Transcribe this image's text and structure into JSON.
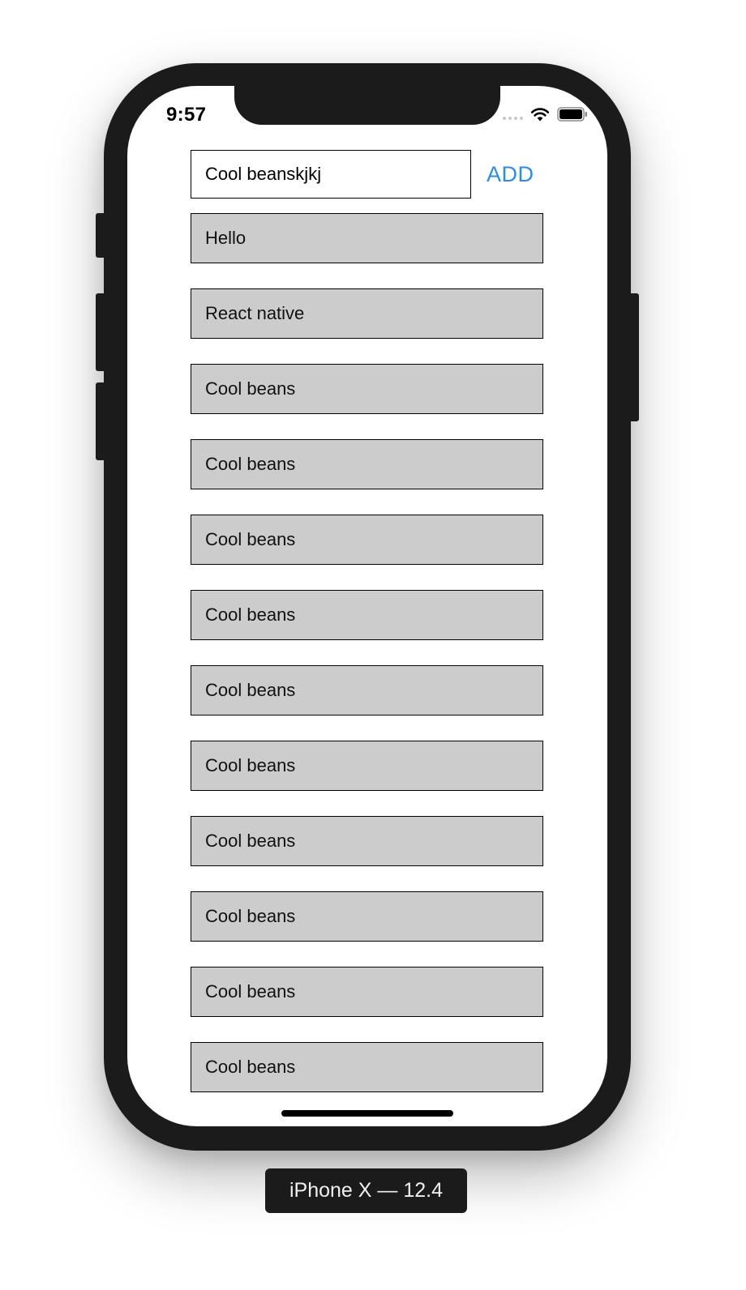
{
  "status_bar": {
    "time": "9:57"
  },
  "input": {
    "value": "Cool beanskjkj"
  },
  "add_button": {
    "label": "ADD",
    "color": "#2b8cf0"
  },
  "list": {
    "items": [
      {
        "label": "Hello"
      },
      {
        "label": "React native"
      },
      {
        "label": "Cool beans"
      },
      {
        "label": "Cool beans"
      },
      {
        "label": "Cool beans"
      },
      {
        "label": "Cool beans"
      },
      {
        "label": "Cool beans"
      },
      {
        "label": "Cool beans"
      },
      {
        "label": "Cool beans"
      },
      {
        "label": "Cool beans"
      },
      {
        "label": "Cool beans"
      },
      {
        "label": "Cool beans"
      }
    ]
  },
  "device_label": "iPhone X — 12.4",
  "icons": {
    "wifi": "wifi-icon",
    "battery": "battery-icon",
    "signal": "signal-dots-icon"
  }
}
